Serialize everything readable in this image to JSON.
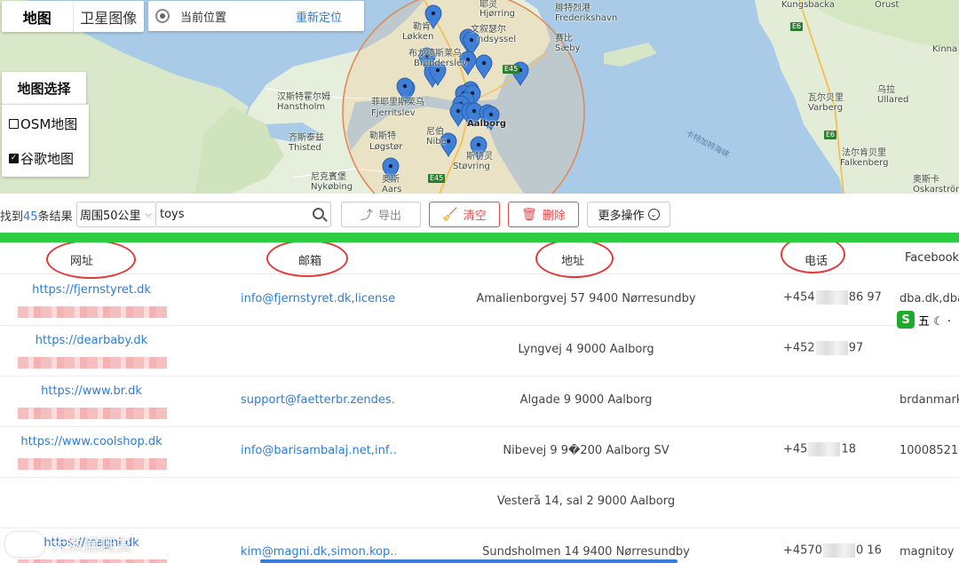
{
  "map_controls": {
    "tabs": [
      "地图",
      "卫星图像"
    ],
    "location_label": "当前位置",
    "relocate_label": "重新定位",
    "map_select_title": "地图选择",
    "options": [
      {
        "label": "OSM地图",
        "checked": false
      },
      {
        "label": "谷歌地图",
        "checked": true
      }
    ]
  },
  "map": {
    "labels": [
      {
        "text": "腓特烈港",
        "bold": false
      },
      {
        "text": "Frederikshavn",
        "bold": false
      },
      {
        "text": "耶灵",
        "bold": false
      },
      {
        "text": "Hjørring",
        "bold": false
      },
      {
        "text": "勒肯",
        "bold": false
      },
      {
        "text": "Løkken",
        "bold": false
      },
      {
        "text": "文叙瑟尔",
        "bold": false
      },
      {
        "text": "ndsyssel",
        "bold": false
      },
      {
        "text": "赛比",
        "bold": false
      },
      {
        "text": "Sæby",
        "bold": false
      },
      {
        "text": "布龙德斯莱乌",
        "bold": false
      },
      {
        "text": "Brønderslev",
        "bold": false
      },
      {
        "text": "汉斯特霍尔姆",
        "bold": false
      },
      {
        "text": "Hanstholm",
        "bold": false
      },
      {
        "text": "菲耶里斯莱乌",
        "bold": false
      },
      {
        "text": "Fjerritslev",
        "bold": false
      },
      {
        "text": "Aalborg",
        "bold": true
      },
      {
        "text": "齐斯泰兹",
        "bold": false
      },
      {
        "text": "Thisted",
        "bold": false
      },
      {
        "text": "勒斯特",
        "bold": false
      },
      {
        "text": "Løgstør",
        "bold": false
      },
      {
        "text": "尼伯",
        "bold": false
      },
      {
        "text": "Nibe",
        "bold": false
      },
      {
        "text": "斯特灵",
        "bold": false
      },
      {
        "text": "Støvring",
        "bold": false
      },
      {
        "text": "尼克賓堡",
        "bold": false
      },
      {
        "text": "Nykøbing",
        "bold": false
      },
      {
        "text": "奥斯",
        "bold": false
      },
      {
        "text": "Aars",
        "bold": false
      },
      {
        "text": "Kungsbacka",
        "bold": false
      },
      {
        "text": "Orust",
        "bold": false
      },
      {
        "text": "乌拉",
        "bold": false
      },
      {
        "text": "Ullared",
        "bold": false
      },
      {
        "text": "瓦尔贝里",
        "bold": false
      },
      {
        "text": "Varberg",
        "bold": false
      },
      {
        "text": "法尔肯贝里",
        "bold": false
      },
      {
        "text": "Falkenberg",
        "bold": false
      },
      {
        "text": "奥斯卡",
        "bold": false
      },
      {
        "text": "Oskarström",
        "bold": false
      },
      {
        "text": "Kinna",
        "bold": false
      }
    ],
    "sea_label": "卡特加特海峡",
    "roads": [
      "E6",
      "E6",
      "E45",
      "E45"
    ]
  },
  "toolbar": {
    "found_prefix": "找到",
    "found_count": "45",
    "found_suffix": "条结果",
    "radius": "周围50公里",
    "search_value": "toys",
    "export": "导出",
    "clear": "清空",
    "delete": "删除",
    "more": "更多操作"
  },
  "table": {
    "headers": [
      "网址",
      "邮箱",
      "地址",
      "电话",
      "Facebook"
    ],
    "rows": [
      {
        "website": "https://fjernstyret.dk",
        "email": "info@fjernstyret.dk,license…",
        "address": "Amalienborgvej 57 9400 Nørresundby",
        "phone_start": "+454",
        "phone_end": "86 97",
        "facebook": "dba.dk,dba"
      },
      {
        "website": "https://dearbaby.dk",
        "email": "",
        "address": "Lyngvej 4 9000 Aalborg",
        "phone_start": "+452",
        "phone_end": "97",
        "facebook": ""
      },
      {
        "website": "https://www.br.dk",
        "email": "support@faetterbr.zendes…",
        "address": "Algade 9 9000 Aalborg",
        "phone_start": "",
        "phone_end": "",
        "facebook": "brdanmark"
      },
      {
        "website": "https://www.coolshop.dk",
        "email": "info@barisambalaj.net,inf…",
        "address": "Nibevej 9 9�200 Aalborg SV",
        "phone_start": "+45",
        "phone_end": "18",
        "facebook": "100085210"
      },
      {
        "website": "",
        "email": "",
        "address": "Vesterå 14, sal 2 9000 Aalborg",
        "phone_start": "",
        "phone_end": "",
        "facebook": ""
      },
      {
        "website": "https://magni.dk",
        "email": "kim@magni.dk,simon.kop…",
        "address": "Sundsholmen 14 9400 Nørresundby",
        "phone_start": "+4570",
        "phone_end": "0 16",
        "facebook": "magnitoy"
      }
    ]
  },
  "ime": {
    "logo": "S",
    "text": "五 ☾ ·"
  },
  "watermark": "大数据爬虫"
}
